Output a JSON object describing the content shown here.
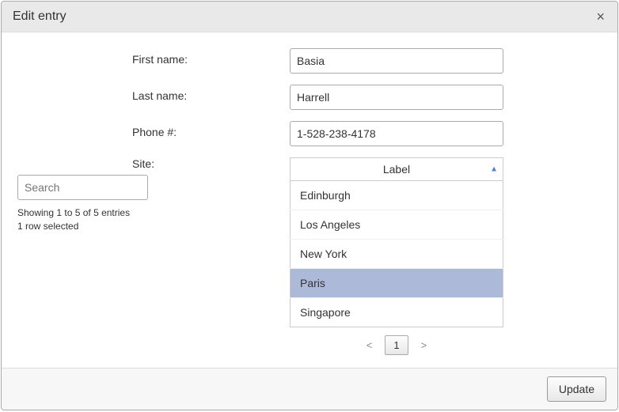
{
  "modal": {
    "title": "Edit entry",
    "close_symbol": "×"
  },
  "fields": {
    "first_name": {
      "label": "First name:",
      "value": "Basia"
    },
    "last_name": {
      "label": "Last name:",
      "value": "Harrell"
    },
    "phone": {
      "label": "Phone #:",
      "value": "1-528-238-4178"
    },
    "site": {
      "label": "Site:"
    }
  },
  "search": {
    "placeholder": "Search"
  },
  "info": {
    "showing": "Showing 1 to 5 of 5 entries",
    "selected": "1 row selected"
  },
  "table": {
    "header": "Label",
    "sort_symbol": "▲",
    "rows": [
      {
        "label": "Edinburgh",
        "selected": false
      },
      {
        "label": "Los Angeles",
        "selected": false
      },
      {
        "label": "New York",
        "selected": false
      },
      {
        "label": "Paris",
        "selected": true
      },
      {
        "label": "Singapore",
        "selected": false
      }
    ]
  },
  "pagination": {
    "prev": "<",
    "page": "1",
    "next": ">"
  },
  "footer": {
    "update": "Update"
  }
}
